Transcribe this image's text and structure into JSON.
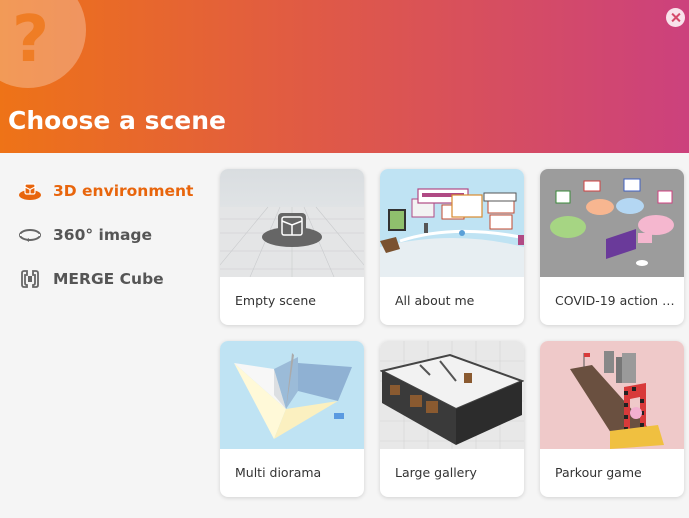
{
  "header": {
    "title": "Choose a scene",
    "help_icon": "question-mark-icon",
    "close_icon": "close-icon",
    "gradient": [
      "#ee7317",
      "#cc417d"
    ]
  },
  "sidebar": {
    "items": [
      {
        "label": "3D environment",
        "icon": "cube-hat-icon",
        "active": true
      },
      {
        "label": "360° image",
        "icon": "rotate-360-icon",
        "active": false
      },
      {
        "label": "MERGE Cube",
        "icon": "merge-cube-icon",
        "active": false
      }
    ],
    "accent": "#e8650c"
  },
  "scenes": [
    {
      "label": "Empty scene"
    },
    {
      "label": "All about me"
    },
    {
      "label": "COVID-19 action pl..."
    },
    {
      "label": "Multi diorama"
    },
    {
      "label": "Large gallery"
    },
    {
      "label": "Parkour game"
    }
  ]
}
